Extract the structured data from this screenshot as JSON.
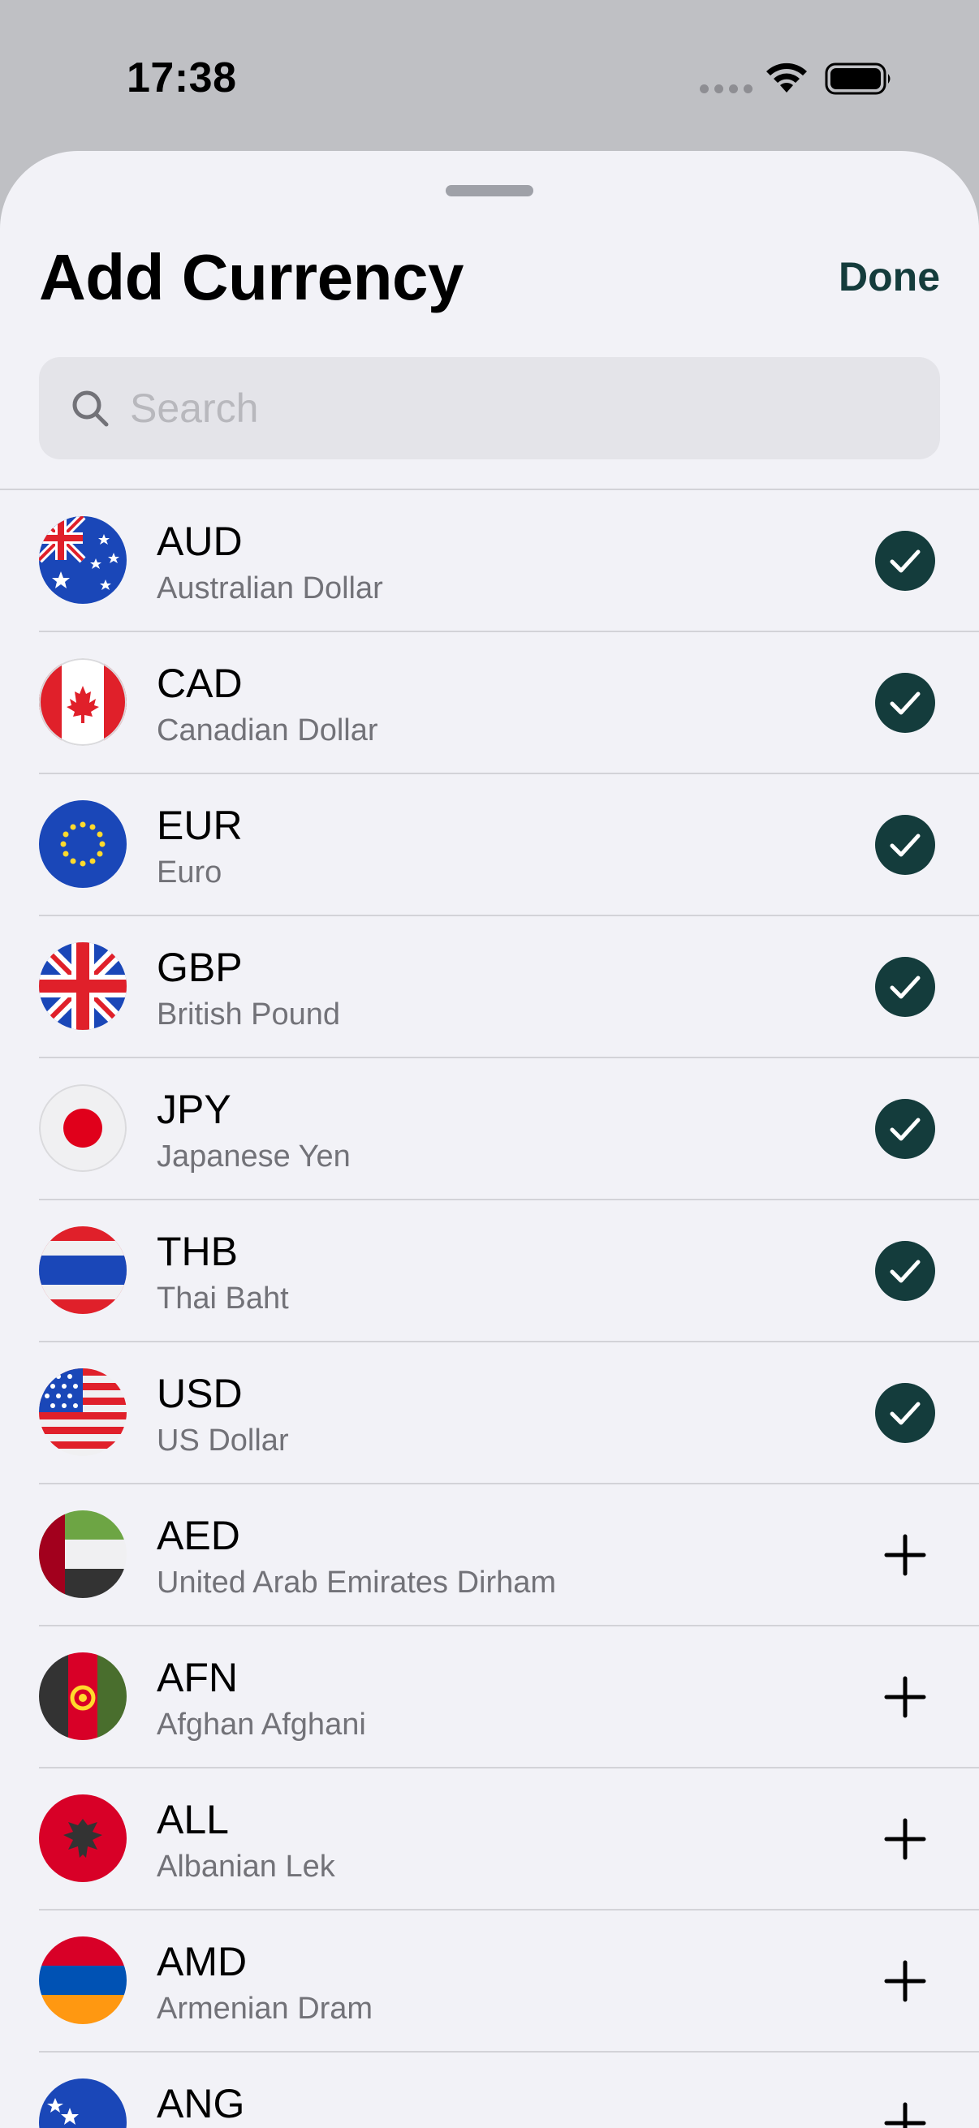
{
  "status_bar": {
    "time": "17:38"
  },
  "sheet": {
    "title": "Add Currency",
    "done_label": "Done",
    "search_placeholder": "Search"
  },
  "colors": {
    "accent": "#143c3c",
    "background": "#f2f2f7",
    "secondary_text": "#727278"
  },
  "currencies": [
    {
      "code": "AUD",
      "name": "Australian Dollar",
      "flag": "australia-flag",
      "selected": true
    },
    {
      "code": "CAD",
      "name": "Canadian Dollar",
      "flag": "canada-flag",
      "selected": true
    },
    {
      "code": "EUR",
      "name": "Euro",
      "flag": "eu-flag",
      "selected": true
    },
    {
      "code": "GBP",
      "name": "British Pound",
      "flag": "uk-flag",
      "selected": true
    },
    {
      "code": "JPY",
      "name": "Japanese Yen",
      "flag": "japan-flag",
      "selected": true
    },
    {
      "code": "THB",
      "name": "Thai Baht",
      "flag": "thailand-flag",
      "selected": true
    },
    {
      "code": "USD",
      "name": "US Dollar",
      "flag": "usa-flag",
      "selected": true
    },
    {
      "code": "AED",
      "name": "United Arab Emirates Dirham",
      "flag": "uae-flag",
      "selected": false
    },
    {
      "code": "AFN",
      "name": "Afghan Afghani",
      "flag": "afghanistan-flag",
      "selected": false
    },
    {
      "code": "ALL",
      "name": "Albanian Lek",
      "flag": "albania-flag",
      "selected": false
    },
    {
      "code": "AMD",
      "name": "Armenian Dram",
      "flag": "armenia-flag",
      "selected": false
    },
    {
      "code": "ANG",
      "name": "",
      "flag": "curacao-flag",
      "selected": false
    }
  ]
}
